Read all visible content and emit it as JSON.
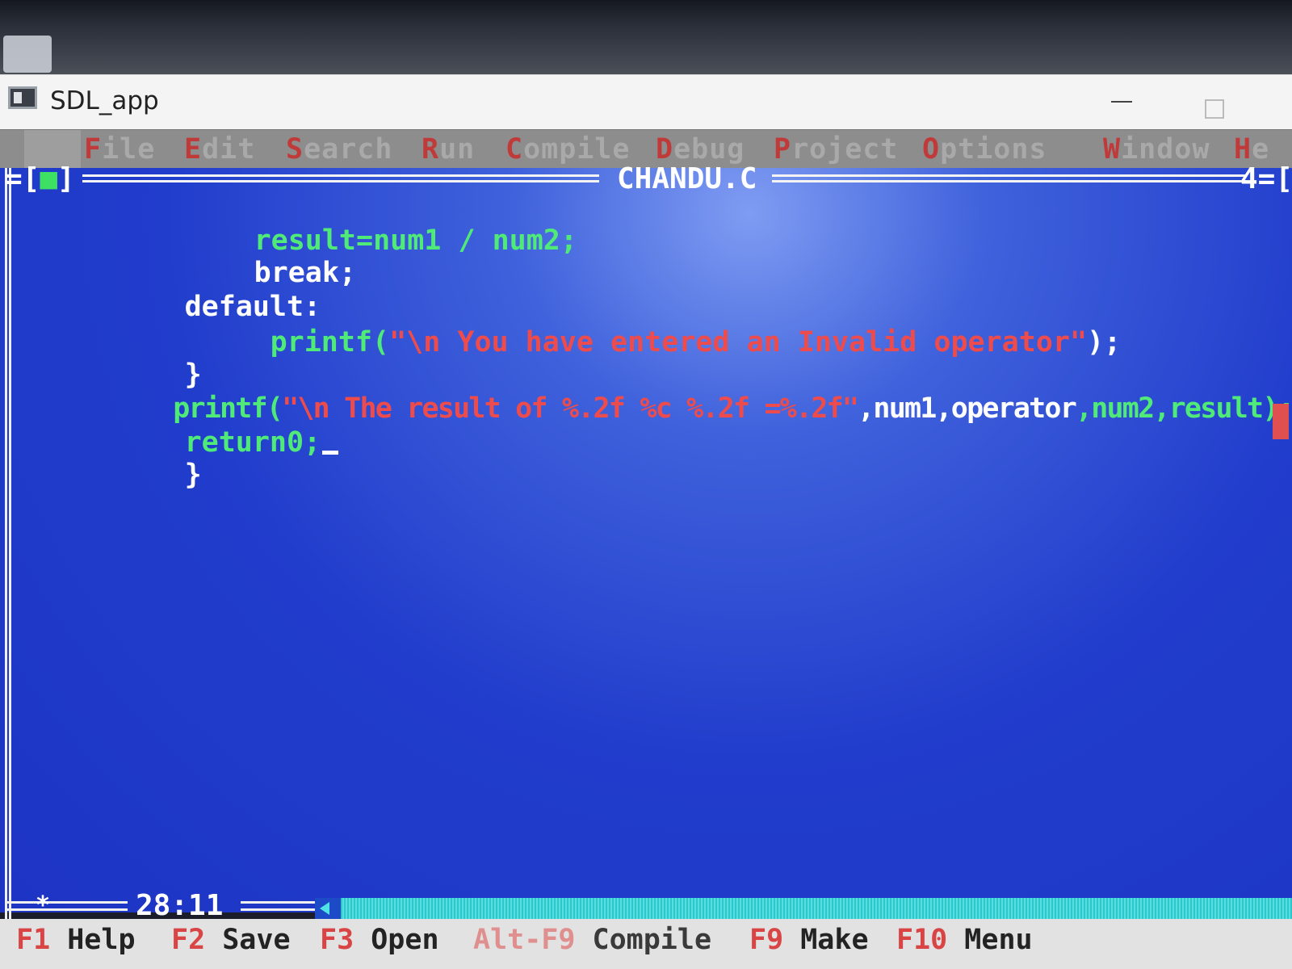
{
  "window": {
    "title": "SDL_app"
  },
  "menu": [
    {
      "hot": "F",
      "rest": "ile"
    },
    {
      "hot": "E",
      "rest": "dit"
    },
    {
      "hot": "S",
      "rest": "earch"
    },
    {
      "hot": "R",
      "rest": "un"
    },
    {
      "hot": "C",
      "rest": "ompile"
    },
    {
      "hot": "D",
      "rest": "ebug"
    },
    {
      "hot": "P",
      "rest": "roject"
    },
    {
      "hot": "O",
      "rest": "ptions"
    },
    {
      "hot": "W",
      "rest": "indow"
    },
    {
      "hot": "H",
      "rest": "e"
    }
  ],
  "editor": {
    "frame_left": "=[",
    "close_mark": "■",
    "frame_left_end": "]",
    "filename": "CHANDU.C",
    "frame_right": "4=[",
    "code": [
      [
        {
          "t": "result=num1 / num2;",
          "c": "green"
        }
      ],
      [
        {
          "t": "break;",
          "c": "white"
        }
      ],
      [
        {
          "t": "default:",
          "c": "white"
        }
      ],
      [
        {
          "t": "printf(",
          "c": "green"
        },
        {
          "t": "\"\\n You have entered an Invalid operator\"",
          "c": "red"
        },
        {
          "t": ");",
          "c": "white"
        }
      ],
      [
        {
          "t": "}",
          "c": "white"
        }
      ],
      [
        {
          "t": "printf(",
          "c": "green"
        },
        {
          "t": "\"\\n The result of %.2f %c %.2f =%.2f\"",
          "c": "red"
        },
        {
          "t": ",num1,",
          "c": "white"
        },
        {
          "t": "operator",
          "c": "white"
        },
        {
          "t": ",num2,",
          "c": "green"
        },
        {
          "t": "result);",
          "c": "green"
        }
      ],
      [
        {
          "t": "return0;",
          "c": "green"
        }
      ],
      [
        {
          "t": "}",
          "c": "white"
        }
      ]
    ],
    "cursor_position": "28:11",
    "bottom_left_mark": "*"
  },
  "statusbar": [
    {
      "key": "F1",
      "label": "Help"
    },
    {
      "key": "F2",
      "label": "Save"
    },
    {
      "key": "F3",
      "label": "Open"
    },
    {
      "key": "Alt-F9",
      "label": "Compile"
    },
    {
      "key": "F9",
      "label": "Make"
    },
    {
      "key": "F10",
      "label": "Menu"
    }
  ],
  "colors": {
    "editor_bg": "#213dcc",
    "menu_bg": "#8d8d8d",
    "status_bg": "#e2e2e2",
    "keyword_green": "#4fea78",
    "string_red": "#ee4c4c",
    "text_white": "#ffffff",
    "scrollbar_cyan": "#2fc5cb"
  }
}
